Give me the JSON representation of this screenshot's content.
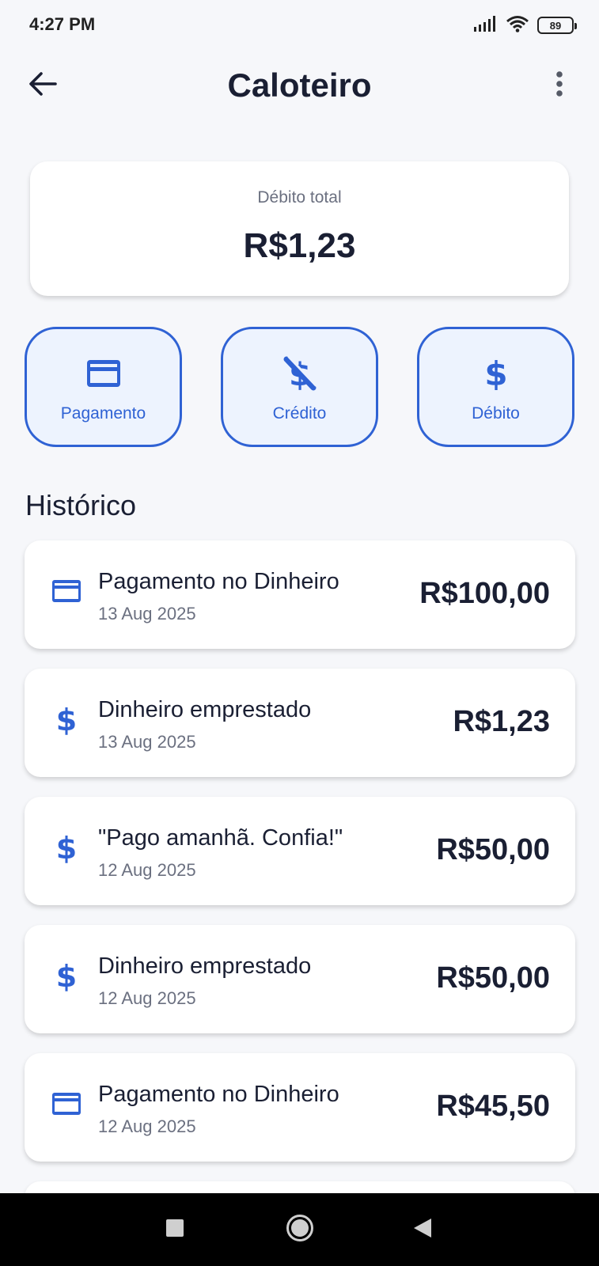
{
  "status_bar": {
    "time": "4:27 PM",
    "battery_level": "89",
    "icons": [
      "signal-icon",
      "wifi-icon",
      "battery-icon"
    ]
  },
  "app_bar": {
    "title": "Caloteiro",
    "back_icon": "arrow-left-icon",
    "menu_icon": "more-vertical-icon"
  },
  "summary": {
    "label": "Débito total",
    "value": "R$1,23"
  },
  "actions": [
    {
      "label": "Pagamento",
      "icon": "credit-card-icon"
    },
    {
      "label": "Crédito",
      "icon": "money-off-icon"
    },
    {
      "label": "Débito",
      "icon": "dollar-icon"
    }
  ],
  "history": {
    "title": "Histórico",
    "items": [
      {
        "icon": "credit-card-icon",
        "title": "Pagamento no Dinheiro",
        "date": "13 Aug 2025",
        "amount": "R$100,00"
      },
      {
        "icon": "dollar-icon",
        "title": "Dinheiro emprestado",
        "date": "13 Aug 2025",
        "amount": "R$1,23"
      },
      {
        "icon": "dollar-icon",
        "title": "\"Pago amanhã. Confia!\"",
        "date": "12 Aug 2025",
        "amount": "R$50,00"
      },
      {
        "icon": "dollar-icon",
        "title": "Dinheiro emprestado",
        "date": "12 Aug 2025",
        "amount": "R$50,00"
      },
      {
        "icon": "credit-card-icon",
        "title": "Pagamento no Dinheiro",
        "date": "12 Aug 2025",
        "amount": "R$45,50"
      }
    ]
  },
  "nav_bar": {
    "icons": [
      "recents-square-icon",
      "home-circle-icon",
      "back-triangle-icon"
    ]
  },
  "colors": {
    "accent": "#2f62d4",
    "accent_bg": "#edf3fe",
    "text_primary": "#1a1f33",
    "text_secondary": "#6b7080",
    "background": "#f6f7fa"
  }
}
